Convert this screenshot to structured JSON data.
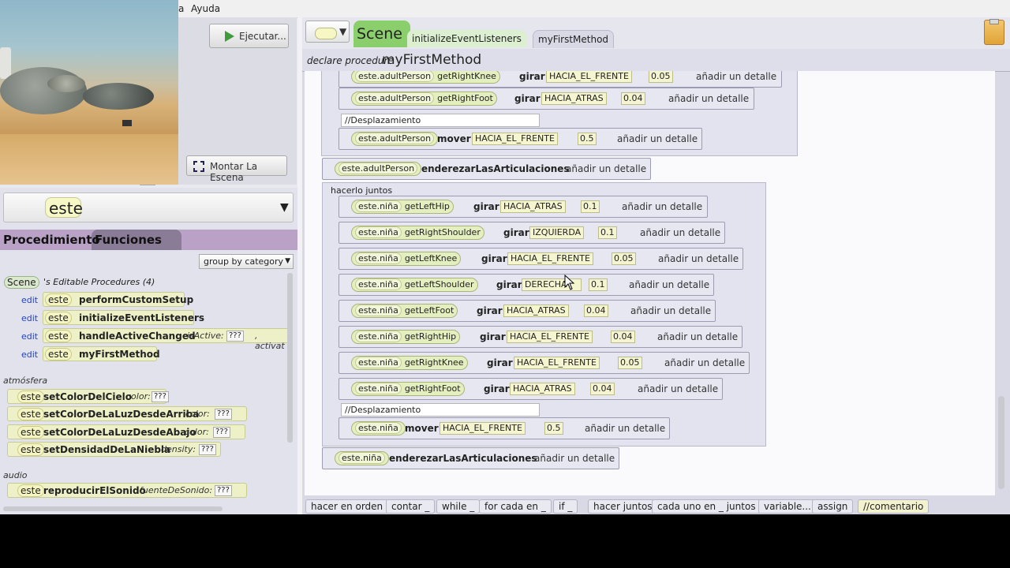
{
  "menu": {
    "item_partial": "a",
    "help": "Ayuda"
  },
  "run_button": "Ejecutar...",
  "setup_scene_button": "Montar La Escena",
  "search": {
    "value": "este"
  },
  "tabs": {
    "procedure": "Procedimiento",
    "functions": "Funciones"
  },
  "group_select": "group by category",
  "scene_chip": "Scene",
  "editable_header": "'s Editable Procedures (4)",
  "edit_label": "edit",
  "este": "este",
  "qmark": "???",
  "procedures": [
    {
      "name": "performCustomSetup"
    },
    {
      "name": "initializeEventListeners"
    },
    {
      "name": "handleActiveChanged",
      "param": "isActive:",
      "extra": ", activat"
    },
    {
      "name": "myFirstMethod"
    }
  ],
  "categories": {
    "atmosphere": "atmósfera",
    "audio": "audio"
  },
  "atmos_procs": [
    {
      "name": "setColorDelCielo",
      "param": "color:"
    },
    {
      "name": "setColorDeLaLuzDesdeArriba",
      "param": "color:"
    },
    {
      "name": "setColorDeLaLuzDesdeAbajo",
      "param": "color:"
    },
    {
      "name": "setDensidadDeLaNiebla",
      "param": "density:"
    }
  ],
  "audio_procs": [
    {
      "name": "reproducirElSonido",
      "param": "fuenteDeSonido:"
    }
  ],
  "editor_tabs": {
    "scene": "Scene",
    "t1": "initializeEventListeners",
    "t2": "myFirstMethod"
  },
  "declare": {
    "prefix": "declare procedure",
    "name": "myFirstMethod"
  },
  "code": {
    "adult_top": [
      {
        "obj": "este.adultPerson",
        "meth": "getRightKnee",
        "verb": "girar",
        "dir": "HACIA_EL_FRENTE",
        "num": "0.05",
        "det": "añadir un detalle"
      },
      {
        "obj": "este.adultPerson",
        "meth": "getRightFoot",
        "verb": "girar",
        "dir": "HACIA_ATRAS",
        "num": "0.04",
        "det": "añadir un detalle"
      }
    ],
    "comment1": "//Desplazamiento",
    "adult_move": {
      "obj": "este.adultPerson",
      "verb": "mover",
      "dir": "HACIA_EL_FRENTE",
      "num": "0.5",
      "det": "añadir un detalle"
    },
    "adult_straight": {
      "obj": "este.adultPerson",
      "verb": "enderezarLasArticulaciones",
      "det": "añadir un detalle"
    },
    "together_label": "hacerlo juntos",
    "nina_rows": [
      {
        "obj": "este.niña",
        "meth": "getLeftHip",
        "verb": "girar",
        "dir": "HACIA_ATRAS",
        "num": "0.1",
        "det": "añadir un detalle"
      },
      {
        "obj": "este.niña",
        "meth": "getRightShoulder",
        "verb": "girar",
        "dir": "IZQUIERDA",
        "num": "0.1",
        "det": "añadir un detalle"
      },
      {
        "obj": "este.niña",
        "meth": "getLeftKnee",
        "verb": "girar",
        "dir": "HACIA_EL_FRENTE",
        "num": "0.05",
        "det": "añadir un detalle"
      },
      {
        "obj": "este.niña",
        "meth": "getLeftShoulder",
        "verb": "girar",
        "dir": "DERECHA",
        "num": "0.1",
        "det": "añadir un detalle"
      },
      {
        "obj": "este.niña",
        "meth": "getLeftFoot",
        "verb": "girar",
        "dir": "HACIA_ATRAS",
        "num": "0.04",
        "det": "añadir un detalle"
      },
      {
        "obj": "este.niña",
        "meth": "getRightHip",
        "verb": "girar",
        "dir": "HACIA_EL_FRENTE",
        "num": "0.04",
        "det": "añadir un detalle"
      },
      {
        "obj": "este.niña",
        "meth": "getRightKnee",
        "verb": "girar",
        "dir": "HACIA_EL_FRENTE",
        "num": "0.05",
        "det": "añadir un detalle"
      },
      {
        "obj": "este.niña",
        "meth": "getRightFoot",
        "verb": "girar",
        "dir": "HACIA_ATRAS",
        "num": "0.04",
        "det": "añadir un detalle"
      }
    ],
    "comment2": "//Desplazamiento",
    "nina_move": {
      "obj": "este.niña",
      "verb": "mover",
      "dir": "HACIA_EL_FRENTE",
      "num": "0.5",
      "det": "añadir un detalle"
    },
    "nina_straight": {
      "obj": "este.niña",
      "verb": "enderezarLasArticulaciones",
      "det": "añadir un detalle"
    }
  },
  "toolbar": [
    "hacer en orden",
    "contar _",
    "while _",
    "for cada en _",
    "if _",
    "hacer juntos",
    "cada uno en _ juntos",
    "variable...",
    "assign",
    "//comentario"
  ]
}
